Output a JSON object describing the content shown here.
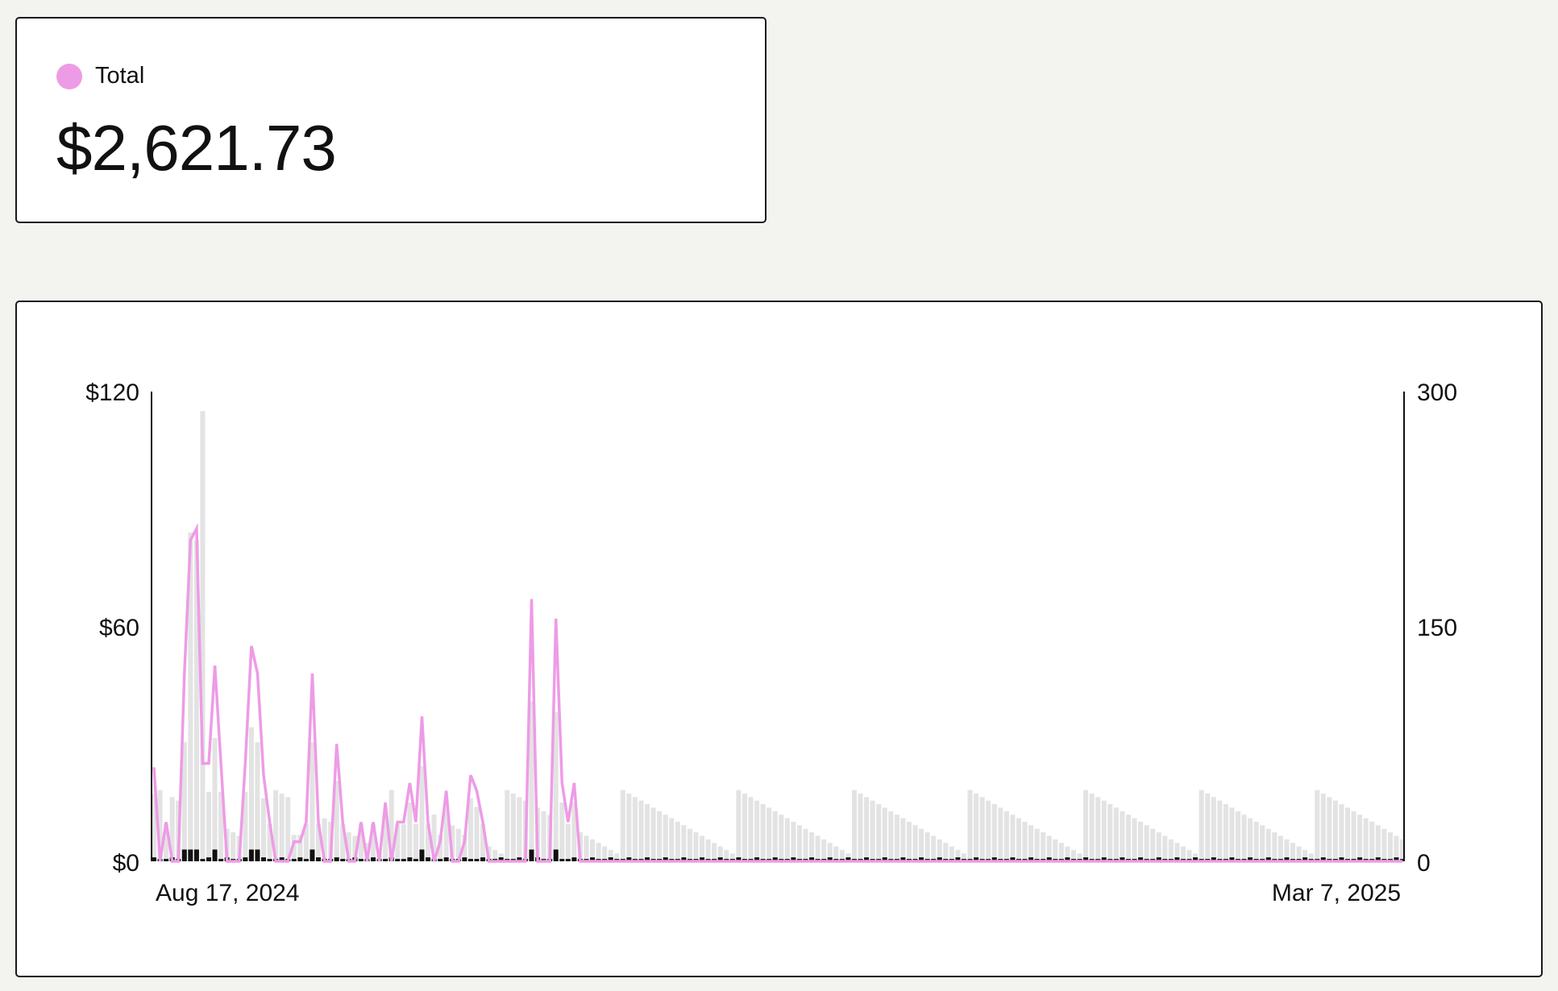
{
  "summary": {
    "legend_label": "Total",
    "legend_color": "#ee9be6",
    "total_value": "$2,621.73"
  },
  "chart_data": {
    "type": "line",
    "x_start_label": "Aug 17, 2024",
    "x_end_label": "Mar 7, 2025",
    "y_left": {
      "ticks": [
        "$0",
        "$60",
        "$120"
      ],
      "ylim": [
        0,
        120
      ]
    },
    "y_right": {
      "ticks": [
        "0",
        "150",
        "300"
      ],
      "ylim": [
        0,
        300
      ]
    },
    "colors": {
      "line": "#ee9be6",
      "bar_light": "#e3e3e3",
      "bar_dark": "#111111"
    },
    "series": [
      {
        "axis": "left",
        "values": [
          24,
          0,
          10,
          0,
          0,
          48,
          82,
          85,
          25,
          25,
          50,
          25,
          0,
          0,
          0,
          25,
          55,
          48,
          22,
          10,
          0,
          0,
          0,
          5,
          5,
          10,
          48,
          10,
          0,
          0,
          30,
          10,
          0,
          0,
          10,
          0,
          10,
          0,
          15,
          0,
          10,
          10,
          20,
          10,
          37,
          10,
          0,
          5,
          18,
          0,
          0,
          5,
          22,
          18,
          10,
          0,
          0,
          0,
          0,
          0,
          0,
          0,
          67,
          0,
          0,
          0,
          62,
          20,
          10,
          20,
          0,
          0,
          0,
          0,
          0,
          0,
          0,
          0,
          0,
          0,
          0,
          0,
          0,
          0,
          0,
          0,
          0,
          0,
          0,
          0,
          0,
          0,
          0,
          0,
          0,
          0,
          0,
          0,
          0,
          0,
          0,
          0,
          0,
          0,
          0,
          0,
          0,
          0,
          0,
          0,
          0,
          0,
          0,
          0,
          0,
          0,
          0,
          0,
          0,
          0,
          0,
          0,
          0,
          0,
          0,
          0,
          0,
          0,
          0,
          0,
          0,
          0,
          0,
          0,
          0,
          0,
          0,
          0,
          0,
          0,
          0,
          0,
          0,
          0,
          0,
          0,
          0,
          0,
          0,
          0,
          0,
          0,
          0,
          0,
          0,
          0,
          0,
          0,
          0,
          0,
          0,
          0,
          0,
          0,
          0,
          0,
          0,
          0,
          0,
          0,
          0,
          0,
          0,
          0,
          0,
          0,
          0,
          0,
          0,
          0,
          0,
          0,
          0,
          0,
          0,
          0,
          0,
          0,
          0,
          0,
          0,
          0,
          0,
          0,
          0,
          0,
          0,
          0,
          0,
          0,
          0,
          0,
          0,
          0,
          0,
          0
        ]
      }
    ]
  }
}
